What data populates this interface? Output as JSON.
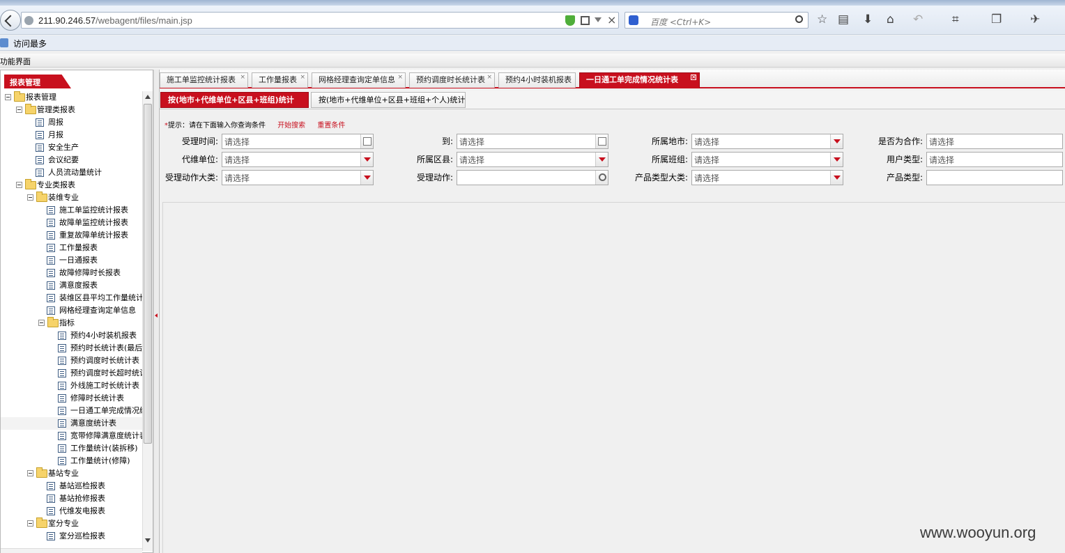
{
  "browser": {
    "url_host": "211.90.246.57",
    "url_path": "/webagent/files/main.jsp",
    "search_placeholder": "百度 <Ctrl+K>",
    "bookmark_label": "访问最多"
  },
  "app": {
    "title": "功能界面"
  },
  "left": {
    "header_tab": "报表管理",
    "tree": [
      {
        "label": "报表管理",
        "type": "folder",
        "level": 0
      },
      {
        "label": "管理类报表",
        "type": "folder",
        "level": 1
      },
      {
        "label": "周报",
        "type": "page",
        "level": 2
      },
      {
        "label": "月报",
        "type": "page",
        "level": 2
      },
      {
        "label": "安全生产",
        "type": "page",
        "level": 2
      },
      {
        "label": "会议纪要",
        "type": "page",
        "level": 2
      },
      {
        "label": "人员流动量统计",
        "type": "page",
        "level": 2
      },
      {
        "label": "专业类报表",
        "type": "folder",
        "level": 1
      },
      {
        "label": "装维专业",
        "type": "folder",
        "level": 2
      },
      {
        "label": "施工单监控统计报表",
        "type": "page",
        "level": 3
      },
      {
        "label": "故障单监控统计报表",
        "type": "page",
        "level": 3
      },
      {
        "label": "重复故障单统计报表",
        "type": "page",
        "level": 3
      },
      {
        "label": "工作量报表",
        "type": "page",
        "level": 3
      },
      {
        "label": "一日通报表",
        "type": "page",
        "level": 3
      },
      {
        "label": "故障修障时长报表",
        "type": "page",
        "level": 3
      },
      {
        "label": "满意度报表",
        "type": "page",
        "level": 3
      },
      {
        "label": "装维区县平均工作量统计",
        "type": "page",
        "level": 3
      },
      {
        "label": "网格经理查询定单信息",
        "type": "page",
        "level": 3
      },
      {
        "label": "指标",
        "type": "folder",
        "level": 3
      },
      {
        "label": "预约4小时装机报表",
        "type": "page",
        "level": 4
      },
      {
        "label": "预约时长统计表(最后",
        "type": "page",
        "level": 4
      },
      {
        "label": "预约调度时长统计表",
        "type": "page",
        "level": 4
      },
      {
        "label": "预约调度时长超时统计",
        "type": "page",
        "level": 4
      },
      {
        "label": "外线施工时长统计表",
        "type": "page",
        "level": 4
      },
      {
        "label": "修障时长统计表",
        "type": "page",
        "level": 4
      },
      {
        "label": "一日通工单完成情况统",
        "type": "page",
        "level": 4
      },
      {
        "label": "满意度统计表",
        "type": "page",
        "level": 4
      },
      {
        "label": "宽带修障满意度统计表",
        "type": "page",
        "level": 4
      },
      {
        "label": "工作量统计(装拆移)",
        "type": "page",
        "level": 4
      },
      {
        "label": "工作量统计(修障)",
        "type": "page",
        "level": 4
      },
      {
        "label": "基站专业",
        "type": "folder",
        "level": 2
      },
      {
        "label": "基站巡检报表",
        "type": "page",
        "level": 3
      },
      {
        "label": "基站抢修报表",
        "type": "page",
        "level": 3
      },
      {
        "label": "代维发电报表",
        "type": "page",
        "level": 3
      },
      {
        "label": "室分专业",
        "type": "folder",
        "level": 2
      },
      {
        "label": "室分巡检报表",
        "type": "page",
        "level": 3
      }
    ]
  },
  "tabs": [
    {
      "label": "施工单监控统计报表"
    },
    {
      "label": "工作量报表"
    },
    {
      "label": "网格经理查询定单信息"
    },
    {
      "label": "预约调度时长统计表"
    },
    {
      "label": "预约4小时装机报表"
    },
    {
      "label": "一日通工单完成情况统计表"
    }
  ],
  "tab_close": "×",
  "subtabs": [
    {
      "label": "按(地市+代维单位+区县+班组)统计"
    },
    {
      "label": "按(地市+代维单位+区县+班组+个人)统计"
    }
  ],
  "hint": {
    "star": "*",
    "text": "提示：请在下面输入你查询条件",
    "start_search": "开始搜索",
    "reset": "重置条件"
  },
  "form": {
    "placeholder": "请选择",
    "fields": [
      {
        "label": "受理时间:",
        "value": "请选择",
        "btn": "cal"
      },
      {
        "label": "到:",
        "value": "请选择",
        "btn": "cal"
      },
      {
        "label": "所属地市:",
        "value": "请选择",
        "btn": "dd"
      },
      {
        "label": "是否为合作:",
        "value": "请选择",
        "btn": "none"
      },
      {
        "label": "代维单位:",
        "value": "请选择",
        "btn": "dd"
      },
      {
        "label": "所属区县:",
        "value": "请选择",
        "btn": "dd"
      },
      {
        "label": "所属班组:",
        "value": "请选择",
        "btn": "dd"
      },
      {
        "label": "用户类型:",
        "value": "请选择",
        "btn": "none"
      },
      {
        "label": "受理动作大类:",
        "value": "请选择",
        "btn": "dd"
      },
      {
        "label": "受理动作:",
        "value": "",
        "btn": "mag"
      },
      {
        "label": "产品类型大类:",
        "value": "请选择",
        "btn": "dd"
      },
      {
        "label": "产品类型:",
        "value": "",
        "btn": "none"
      }
    ]
  },
  "watermark": "www.wooyun.org"
}
